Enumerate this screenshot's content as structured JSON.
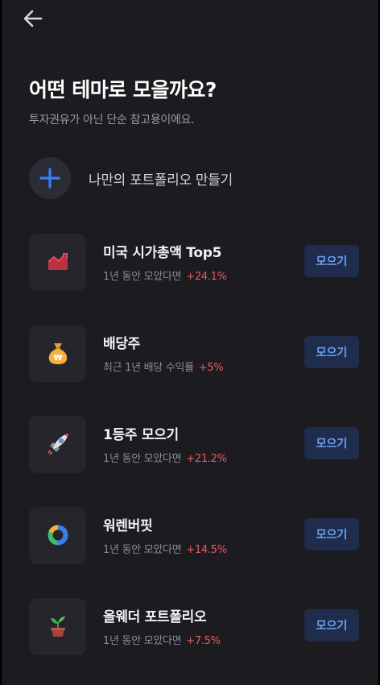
{
  "header": {
    "back_icon": "arrow-left-icon",
    "title": "어떤 테마로 모을까요?",
    "subtitle": "투자권유가 아닌 단순 참고용이에요."
  },
  "create": {
    "icon": "plus-icon",
    "label": "나만의 포트폴리오 만들기",
    "accent": "#3182f6"
  },
  "themes": [
    {
      "name": "미국 시가총액 Top5",
      "sub": "1년 동안 모았다면",
      "rate": "+24.1%",
      "icon": "chart-up-icon",
      "button": "모으기"
    },
    {
      "name": "배당주",
      "sub": "최근 1년 배당 수익률",
      "rate": "+5%",
      "icon": "money-bag-icon",
      "button": "모으기"
    },
    {
      "name": "1등주 모으기",
      "sub": "1년 동안 모았다면",
      "rate": "+21.2%",
      "icon": "rocket-icon",
      "button": "모으기"
    },
    {
      "name": "워렌버핏",
      "sub": "1년 동안 모았다면",
      "rate": "+14.5%",
      "icon": "donut-icon",
      "button": "모으기"
    },
    {
      "name": "올웨더 포트폴리오",
      "sub": "1년 동안 모았다면",
      "rate": "+7.5%",
      "icon": "plant-icon",
      "button": "모으기"
    }
  ],
  "colors": {
    "background": "#1b1b20",
    "card": "#25252b",
    "rate_positive": "#ec5a5e",
    "button_bg": "#1f2c4c",
    "button_text": "#6aa3f5"
  }
}
